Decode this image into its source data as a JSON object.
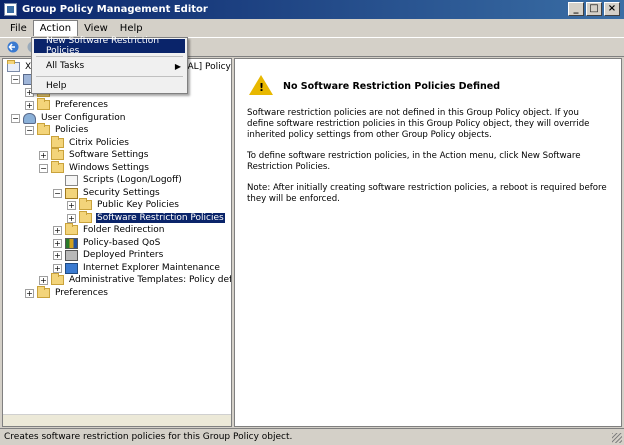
{
  "window": {
    "title": "Group Policy Management Editor",
    "controls": [
      "_",
      "□",
      "×"
    ]
  },
  "menubar": {
    "items": [
      "File",
      "Action",
      "View",
      "Help"
    ],
    "active": "Action"
  },
  "action_menu": {
    "items": [
      {
        "label": "New Software Restriction Policies",
        "highlighted": true
      },
      {
        "label": "All Tasks",
        "submenu": true
      },
      {
        "label": "Help"
      }
    ],
    "submenu_arrow": "▶"
  },
  "tree": {
    "root_partial_left": "X",
    "root_partial_right": "CAL] Policy",
    "items": [
      {
        "label": "Preferences",
        "expander": "+",
        "icon": "folder"
      },
      {
        "label": "User Configuration",
        "expander": "-",
        "icon": "user"
      },
      {
        "label": "Policies",
        "expander": "-",
        "icon": "folder"
      },
      {
        "label": "Citrix Policies",
        "expander": "",
        "icon": "folder"
      },
      {
        "label": "Software Settings",
        "expander": "+",
        "icon": "folder"
      },
      {
        "label": "Windows Settings",
        "expander": "-",
        "icon": "folder"
      },
      {
        "label": "Scripts (Logon/Logoff)",
        "expander": "",
        "icon": "script"
      },
      {
        "label": "Security Settings",
        "expander": "-",
        "icon": "secure"
      },
      {
        "label": "Public Key Policies",
        "expander": "+",
        "icon": "folder"
      },
      {
        "label": "Software Restriction Policies",
        "expander": "+",
        "icon": "folder",
        "selected": true
      },
      {
        "label": "Folder Redirection",
        "expander": "+",
        "icon": "folder"
      },
      {
        "label": "Policy-based QoS",
        "expander": "+",
        "icon": "qos"
      },
      {
        "label": "Deployed Printers",
        "expander": "+",
        "icon": "printer"
      },
      {
        "label": "Internet Explorer Maintenance",
        "expander": "+",
        "icon": "ie"
      },
      {
        "label": "Administrative Templates: Policy definitions",
        "expander": "+",
        "icon": "folder"
      },
      {
        "label": "Preferences",
        "expander": "+",
        "icon": "folder"
      }
    ]
  },
  "content": {
    "heading": "No Software Restriction Policies Defined",
    "paragraph1": "Software restriction policies are not defined in this Group Policy object. If you define software restriction policies in this Group Policy object, they will override inherited policy settings from other Group Policy objects.",
    "paragraph2": "To define software restriction policies, in the Action menu, click New Software Restriction Policies.",
    "paragraph3": "Note: After initially creating software restriction policies, a reboot is required before they will be enforced.",
    "warning_glyph": "!"
  },
  "statusbar": {
    "text": "Creates software restriction policies for this Group Policy object."
  },
  "colors": {
    "selection": "#0a246a",
    "warning": "#e8b800"
  }
}
